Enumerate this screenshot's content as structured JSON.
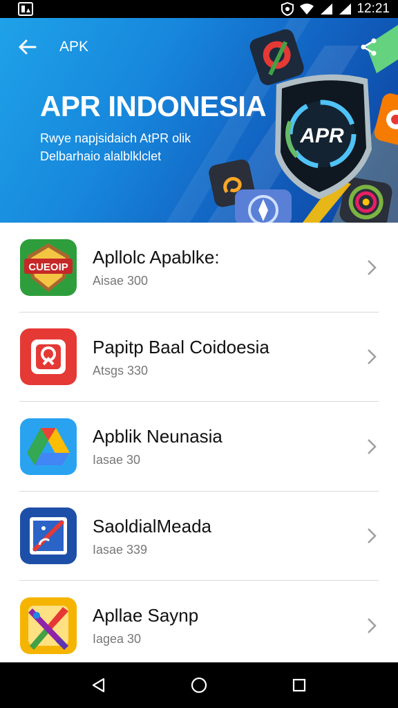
{
  "status_bar": {
    "time": "12:21"
  },
  "app_bar": {
    "title": "APK"
  },
  "hero": {
    "title": "APR INDONESIA",
    "subtitle_line1": "Rwye napjsidaich AtPR olik",
    "subtitle_line2": "Delbarhaio alalblklclet",
    "badge_text": "APR"
  },
  "apps": [
    {
      "title": "Apllolc Apablke:",
      "subtitle": "Aisae 300",
      "icon": "shield-badge-icon",
      "badge_text": "CUEOIP",
      "color": "#2e9e3c"
    },
    {
      "title": "Papitp Baal Coidoesia",
      "subtitle": "Atsgs 330",
      "icon": "camera-pin-icon",
      "color": "#e53935"
    },
    {
      "title": "Apblik Neunasia",
      "subtitle": "Iasae 30",
      "icon": "drive-triangle-icon",
      "color": "#2196f3"
    },
    {
      "title": "SaoldialMeada",
      "subtitle": "Iasae 339",
      "icon": "diagonal-phone-icon",
      "color": "#1e4fa8"
    },
    {
      "title": "Apllae Saynp",
      "subtitle": "Iagea 30",
      "icon": "paint-brushes-icon",
      "color": "#f5b400"
    }
  ]
}
